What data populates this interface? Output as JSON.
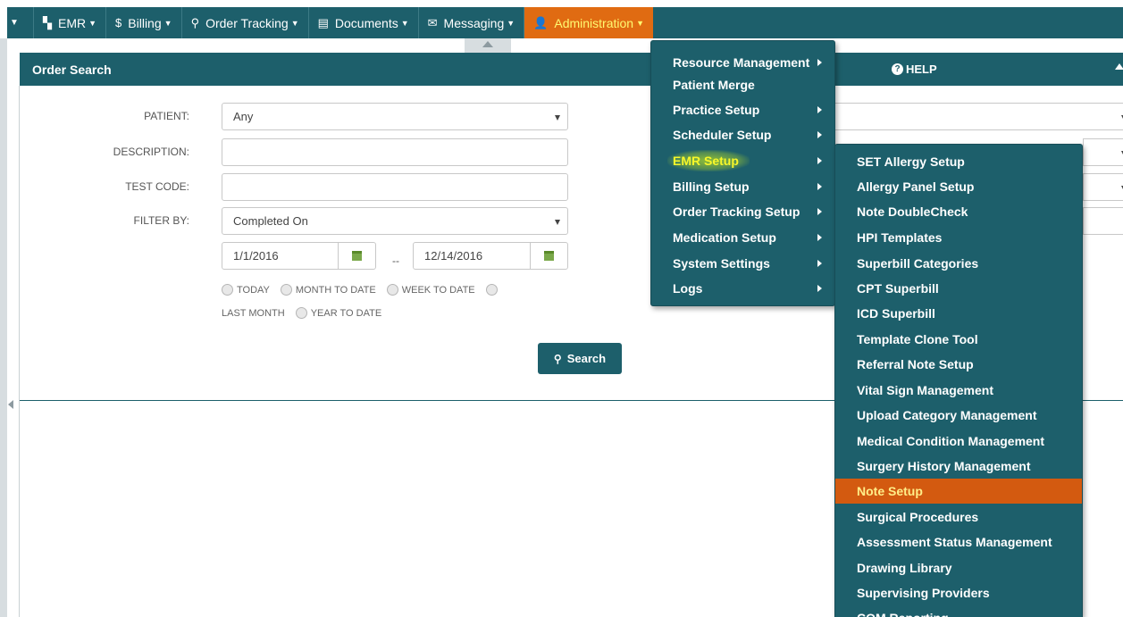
{
  "nav": {
    "items": [
      {
        "label": "EMR",
        "icon": "emr-icon"
      },
      {
        "label": "Billing",
        "icon": "dollar-icon"
      },
      {
        "label": "Order Tracking",
        "icon": "search-icon"
      },
      {
        "label": "Documents",
        "icon": "document-icon"
      },
      {
        "label": "Messaging",
        "icon": "envelope-icon"
      },
      {
        "label": "Administration",
        "icon": "user-icon"
      }
    ]
  },
  "panel": {
    "title": "Order Search",
    "help_label": "HELP"
  },
  "form": {
    "patient_label": "PATIENT:",
    "patient_value": "Any",
    "description_label": "DESCRIPTION:",
    "description_value": "",
    "test_code_label": "TEST CODE:",
    "test_code_value": "",
    "filter_label": "FILTER BY:",
    "filter_value": "Completed On",
    "date_from": "1/1/2016",
    "date_to": "12/14/2016",
    "date_separator": "--",
    "radio_today": "TODAY",
    "radio_month_to_date": "MONTH TO DATE",
    "radio_week_to_date": "WEEK TO DATE",
    "radio_last_month": "LAST MONTH",
    "radio_year_to_date": "YEAR TO DATE",
    "search_label": "Search"
  },
  "admin_menu": {
    "items": [
      "Resource Management",
      "Patient Merge",
      "Practice Setup",
      "Scheduler Setup",
      "EMR Setup",
      "Billing Setup",
      "Order Tracking Setup",
      "Medication Setup",
      "System Settings",
      "Logs"
    ],
    "highlighted": "EMR Setup"
  },
  "emr_menu": {
    "items": [
      "SET Allergy Setup",
      "Allergy Panel Setup",
      "Note DoubleCheck",
      "HPI Templates",
      "Superbill Categories",
      "CPT Superbill",
      "ICD Superbill",
      "Template Clone Tool",
      "Referral Note Setup",
      "Vital Sign Management",
      "Upload Category Management",
      "Medical Condition Management",
      "Surgery History Management",
      "Note Setup",
      "Surgical Procedures",
      "Assessment Status Management",
      "Drawing Library",
      "Supervising Providers",
      "COM Reporting"
    ],
    "active": "Note Setup"
  },
  "colors": {
    "primary": "#1d5f6b",
    "accent": "#e06b12",
    "active_text": "#ffee88"
  }
}
